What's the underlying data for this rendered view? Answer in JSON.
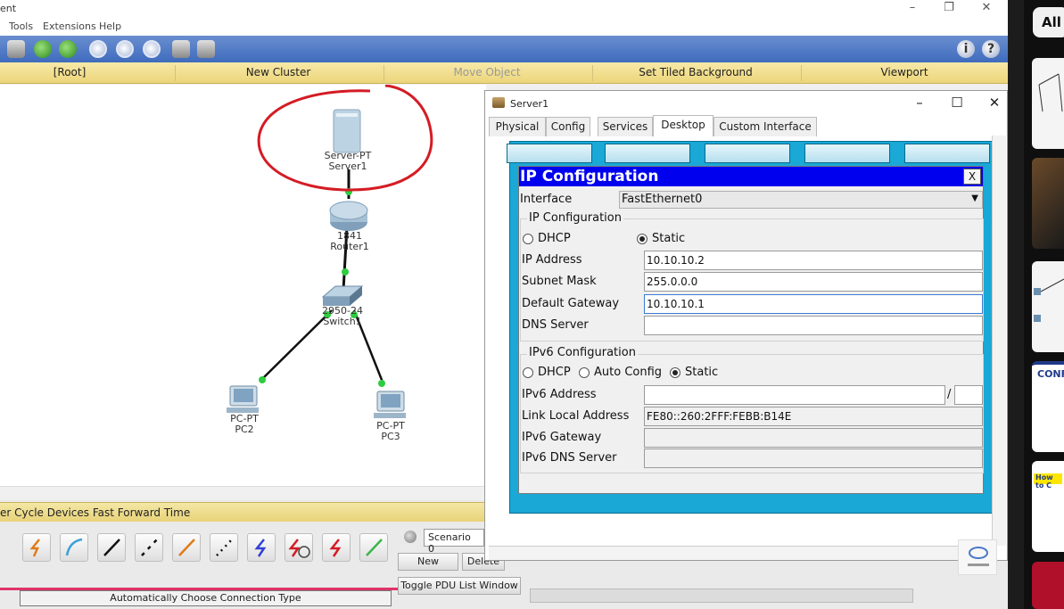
{
  "app": {
    "title_fragment": "ent",
    "menu": [
      "Tools",
      "Extensions",
      "Help"
    ],
    "nav": [
      "[Root]",
      "New Cluster",
      "Move Object",
      "Set Tiled Background",
      "Viewport"
    ]
  },
  "topology": {
    "devices": [
      {
        "type": "Server-PT",
        "name": "Server1"
      },
      {
        "type": "1841",
        "name": "Router1"
      },
      {
        "type": "2950-24",
        "name": "Switch1"
      },
      {
        "type": "PC-PT",
        "name": "PC2"
      },
      {
        "type": "PC-PT",
        "name": "PC3"
      }
    ]
  },
  "bottom": {
    "status_text": "er Cycle Devices  Fast Forward Time",
    "connection_caption": "Automatically Choose Connection Type",
    "scenario": "Scenario 0",
    "new_label": "New",
    "delete_label": "Delete",
    "toggle_pdu": "Toggle PDU List Window"
  },
  "server_window": {
    "title": "Server1",
    "tabs": [
      "Physical",
      "Config",
      "Services",
      "Desktop",
      "Custom Interface"
    ],
    "active_tab": "Desktop",
    "ip_config": {
      "title": "IP Configuration",
      "close_label": "X",
      "interface_label": "Interface",
      "interface_value": "FastEthernet0",
      "ipv4_group": "IP Configuration",
      "dhcp_label": "DHCP",
      "static_label": "Static",
      "ipv4_mode": "Static",
      "ip_address_label": "IP Address",
      "ip_address": "10.10.10.2",
      "subnet_mask_label": "Subnet Mask",
      "subnet_mask": "255.0.0.0",
      "default_gateway_label": "Default Gateway",
      "default_gateway": "10.10.10.1",
      "dns_server_label": "DNS Server",
      "dns_server": "",
      "ipv6_group": "IPv6 Configuration",
      "ipv6_dhcp_label": "DHCP",
      "ipv6_auto_label": "Auto Config",
      "ipv6_static_label": "Static",
      "ipv6_mode": "Static",
      "ipv6_address_label": "IPv6 Address",
      "ipv6_address": "",
      "prefix_sep": "/",
      "link_local_label": "Link Local Address",
      "link_local": "FE80::260:2FFF:FEBB:B14E",
      "ipv6_gateway_label": "IPv6 Gateway",
      "ipv6_gateway": "",
      "ipv6_dns_label": "IPv6 DNS Server",
      "ipv6_dns": ""
    }
  },
  "sidebar": {
    "chip": "All"
  },
  "colors": {
    "toolbar": "#4a78c8",
    "nav_yellow": "#f2e08f",
    "desktop_blue": "#1aa8d6",
    "dialog_title": "#0000ee",
    "annotation_red": "#d41c24",
    "link_green": "#2ecc40"
  }
}
